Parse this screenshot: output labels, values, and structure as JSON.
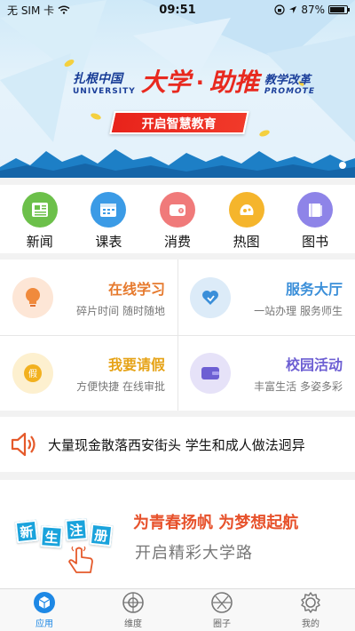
{
  "status_bar": {
    "carrier": "无 SIM 卡",
    "time": "09:51",
    "battery": "87%",
    "battery_level": 0.87
  },
  "banner": {
    "brand_cn": "扎根中国",
    "brand_en": "UNIVERSITY",
    "big_title_1": "大学",
    "dot": "·",
    "big_title_2": "助推",
    "right_cn": "教学改革",
    "right_en": "PROMOTE",
    "slogan": "开启智慧教育"
  },
  "quick_links": [
    {
      "label": "新闻",
      "icon": "news-icon",
      "color": "#6cc04a"
    },
    {
      "label": "课表",
      "icon": "timetable-icon",
      "color": "#3b9be6"
    },
    {
      "label": "消费",
      "icon": "wallet-icon",
      "color": "#f07a7a"
    },
    {
      "label": "热图",
      "icon": "heatmap-icon",
      "color": "#f5b52c"
    },
    {
      "label": "图书",
      "icon": "book-icon",
      "color": "#8e84e8"
    }
  ],
  "services": [
    {
      "title": "在线学习",
      "sub": "碎片时间  随时随地",
      "icon": "lightbulb-icon",
      "title_color": "#e67a2e",
      "bg": "#fde6d6"
    },
    {
      "title": "服务大厅",
      "sub": "一站办理  服务师生",
      "icon": "heart-hands-icon",
      "title_color": "#3b8fd9",
      "bg": "#dcebf8"
    },
    {
      "title": "我要请假",
      "sub": "方便快捷  在线审批",
      "icon": "leave-icon",
      "title_color": "#e6a317",
      "bg": "#fdf0cf"
    },
    {
      "title": "校园活动",
      "sub": "丰富生活  多姿多彩",
      "icon": "wallet-card-icon",
      "title_color": "#6d5fd3",
      "bg": "#e6e2f8"
    }
  ],
  "news_ticker": {
    "icon": "speaker-icon",
    "text": "大量现金散落西安街头 学生和成人做法迥异"
  },
  "promo": {
    "tiles": [
      "新",
      "生",
      "注",
      "册"
    ],
    "tagline": "为青春扬帆 为梦想起航",
    "sub": "开启精彩大学路"
  },
  "tabs": [
    {
      "label": "应用",
      "icon": "cube-icon",
      "active": true
    },
    {
      "label": "维度",
      "icon": "compass-icon",
      "active": false
    },
    {
      "label": "圈子",
      "icon": "aperture-icon",
      "active": false
    },
    {
      "label": "我的",
      "icon": "gear-icon",
      "active": false
    }
  ],
  "colors": {
    "accent": "#1e88e5",
    "banner_red": "#e8291f"
  }
}
